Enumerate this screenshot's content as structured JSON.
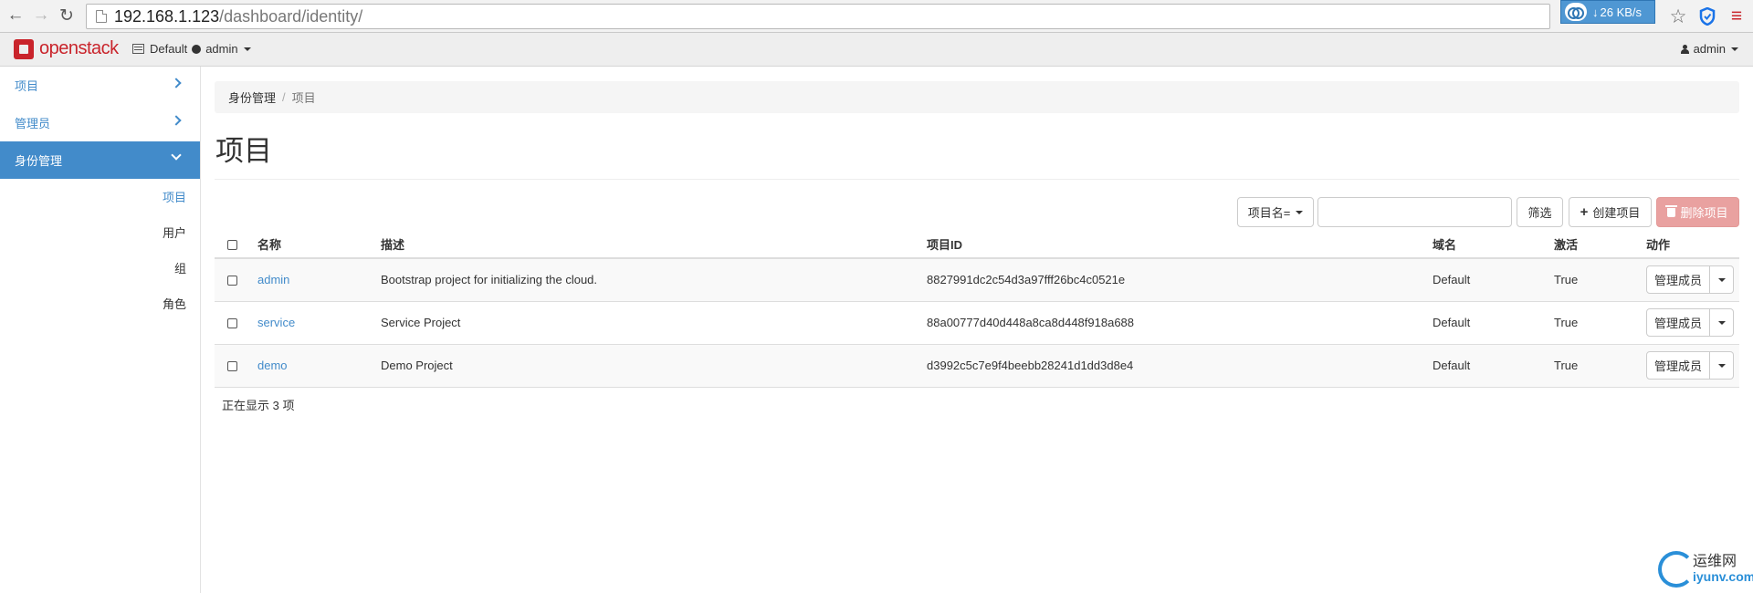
{
  "browser": {
    "url_host": "192.168.1.123",
    "url_path": "/dashboard/identity/",
    "download_speed": "26 KB/s",
    "back_icon": "arrow-left-icon",
    "forward_icon": "arrow-right-icon",
    "reload_icon": "reload-icon",
    "star_icon": "star-icon",
    "shield_icon": "shield-icon",
    "menu_icon": "hamburger-menu-icon"
  },
  "topnav": {
    "brand": "openstack",
    "domain": "Default",
    "project": "admin",
    "user": "admin"
  },
  "sidebar": {
    "items": [
      {
        "label": "项目"
      },
      {
        "label": "管理员"
      },
      {
        "label": "身份管理"
      }
    ],
    "subitems": [
      {
        "label": "项目"
      },
      {
        "label": "用户"
      },
      {
        "label": "组"
      },
      {
        "label": "角色"
      }
    ]
  },
  "breadcrumb": {
    "parent": "身份管理",
    "separator": "/",
    "current": "项目"
  },
  "page": {
    "title": "项目"
  },
  "toolbar": {
    "filter_field": "项目名=",
    "filter_value": "",
    "filter_button": "筛选",
    "create_button": "创建项目",
    "delete_button": "删除项目"
  },
  "table": {
    "headers": {
      "name": "名称",
      "description": "描述",
      "project_id": "项目ID",
      "domain": "域名",
      "enabled": "激活",
      "actions": "动作"
    },
    "rows": [
      {
        "name": "admin",
        "description": "Bootstrap project for initializing the cloud.",
        "project_id": "8827991dc2c54d3a97fff26bc4c0521e",
        "domain": "Default",
        "enabled": "True",
        "action": "管理成员"
      },
      {
        "name": "service",
        "description": "Service Project",
        "project_id": "88a00777d40d448a8ca8d448f918a688",
        "domain": "Default",
        "enabled": "True",
        "action": "管理成员"
      },
      {
        "name": "demo",
        "description": "Demo Project",
        "project_id": "d3992c5c7e9f4beebb28241d1dd3d8e4",
        "domain": "Default",
        "enabled": "True",
        "action": "管理成员"
      }
    ],
    "footer": "正在显示 3 项"
  },
  "watermark": {
    "cn": "运维网",
    "en": "iyunv.com"
  },
  "colors": {
    "accent": "#428bca",
    "brand": "#c9242b",
    "danger": "#e9a1a0"
  }
}
